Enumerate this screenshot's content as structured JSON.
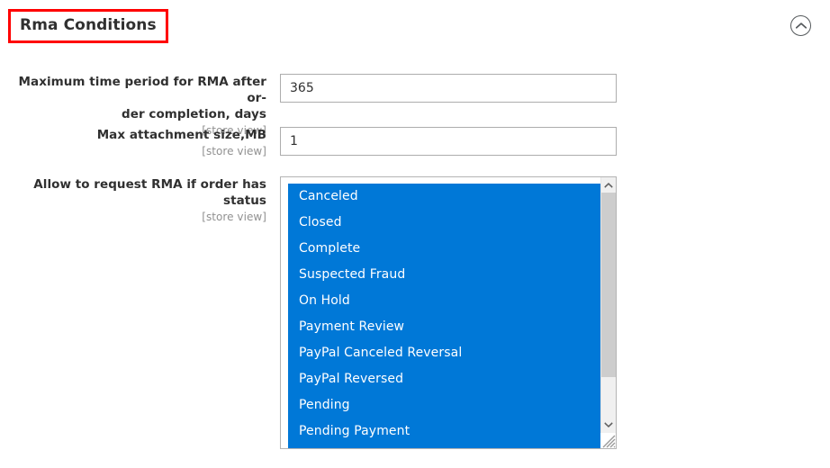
{
  "section": {
    "title": "Rma Conditions",
    "collapse_icon": "chevron-up-circle-icon",
    "highlight_color": "#ff0000",
    "accent_color": "#0078d7"
  },
  "fields": [
    {
      "label": "Maximum time period for RMA after or-der completion, days",
      "label_line1": "Maximum time period for RMA after or-",
      "label_line2": "der completion, days",
      "scope": "[store view]",
      "type": "text",
      "value": "365",
      "placeholder": ""
    },
    {
      "label": "Max attachment size,MB",
      "scope": "[store view]",
      "type": "text",
      "value": "1",
      "placeholder": ""
    },
    {
      "label": "Allow to request RMA if order has status",
      "scope": "[store view]",
      "type": "multiselect",
      "options": [
        {
          "label": "Canceled",
          "selected": true
        },
        {
          "label": "Closed",
          "selected": true
        },
        {
          "label": "Complete",
          "selected": true
        },
        {
          "label": "Suspected Fraud",
          "selected": true
        },
        {
          "label": "On Hold",
          "selected": true
        },
        {
          "label": "Payment Review",
          "selected": true
        },
        {
          "label": "PayPal Canceled Reversal",
          "selected": true
        },
        {
          "label": "PayPal Reversed",
          "selected": true
        },
        {
          "label": "Pending",
          "selected": true
        },
        {
          "label": "Pending Payment",
          "selected": true
        }
      ],
      "scrollbar": {
        "up_icon": "chevron-up-icon",
        "down_icon": "chevron-down-icon",
        "resize_icon": "resize-grip-icon"
      }
    }
  ]
}
